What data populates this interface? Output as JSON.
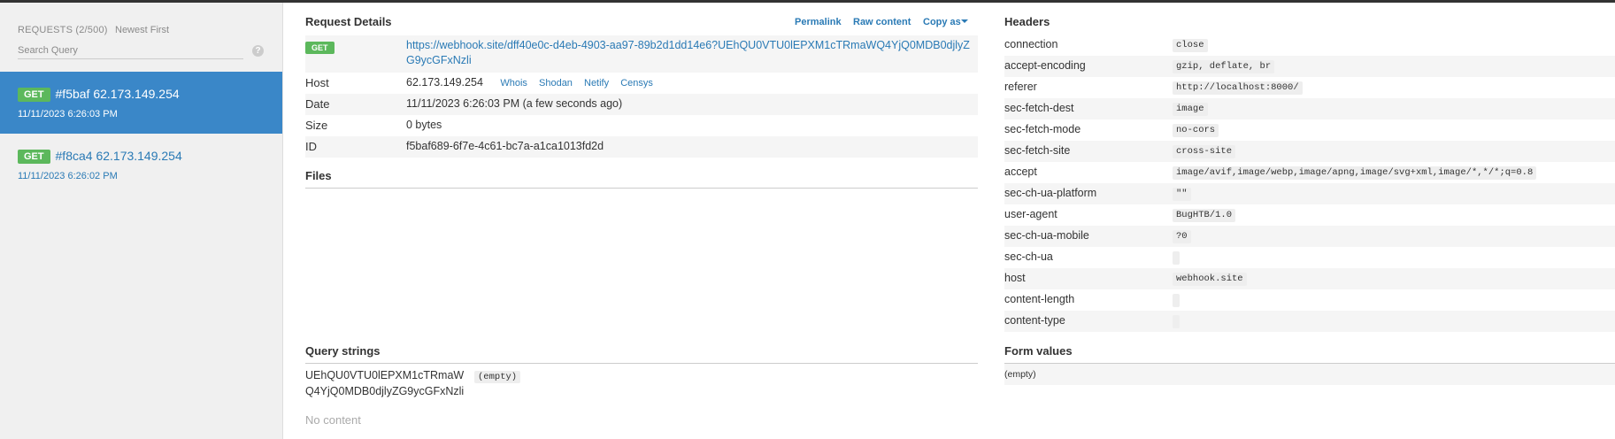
{
  "sidebar": {
    "requests_label": "REQUESTS (2/500)",
    "sort_label": "Newest First",
    "search_placeholder": "Search Query",
    "help_glyph": "?",
    "requests": [
      {
        "method": "GET",
        "title": "#f5baf 62.173.149.254",
        "time": "11/11/2023 6:26:03 PM"
      },
      {
        "method": "GET",
        "title": "#f8ca4 62.173.149.254",
        "time": "11/11/2023 6:26:02 PM"
      }
    ]
  },
  "details": {
    "title": "Request Details",
    "actions": {
      "permalink": "Permalink",
      "raw": "Raw content",
      "copy": "Copy as"
    },
    "method": "GET",
    "url": "https://webhook.site/dff40e0c-d4eb-4903-aa97-89b2d1dd14e6?UEhQU0VTU0lEPXM1cTRmaWQ4YjQ0MDB0djlyZG9ycGFxNzli",
    "host_label": "Host",
    "host": "62.173.149.254",
    "host_links": [
      "Whois",
      "Shodan",
      "Netify",
      "Censys"
    ],
    "date_label": "Date",
    "date": "11/11/2023 6:26:03 PM (a few seconds ago)",
    "size_label": "Size",
    "size": "0 bytes",
    "id_label": "ID",
    "id": "f5baf689-6f7e-4c61-bc7a-a1ca1013fd2d"
  },
  "files": {
    "title": "Files"
  },
  "query": {
    "title": "Query strings",
    "key_line1": "UEhQU0VTU0lEPXM1cTRmaW",
    "key_line2": "Q4YjQ0MDB0djlyZG9ycGFxNzli",
    "value": "(empty)",
    "content": "No content"
  },
  "headers": {
    "title": "Headers",
    "rows": [
      {
        "key": "connection",
        "value": "close"
      },
      {
        "key": "accept-encoding",
        "value": "gzip, deflate, br"
      },
      {
        "key": "referer",
        "value": "http://localhost:8000/"
      },
      {
        "key": "sec-fetch-dest",
        "value": "image"
      },
      {
        "key": "sec-fetch-mode",
        "value": "no-cors"
      },
      {
        "key": "sec-fetch-site",
        "value": "cross-site"
      },
      {
        "key": "accept",
        "value": "image/avif,image/webp,image/apng,image/svg+xml,image/*,*/*;q=0.8"
      },
      {
        "key": "sec-ch-ua-platform",
        "value": "\"\""
      },
      {
        "key": "user-agent",
        "value": "BugHTB/1.0"
      },
      {
        "key": "sec-ch-ua-mobile",
        "value": "?0"
      },
      {
        "key": "sec-ch-ua",
        "value": ""
      },
      {
        "key": "host",
        "value": "webhook.site"
      },
      {
        "key": "content-length",
        "value": ""
      },
      {
        "key": "content-type",
        "value": ""
      }
    ]
  },
  "form": {
    "title": "Form values",
    "value": "(empty)"
  },
  "colors": {
    "accent": "#2a7ab5",
    "active": "#3a87c8",
    "badge": "#5cb85c"
  }
}
